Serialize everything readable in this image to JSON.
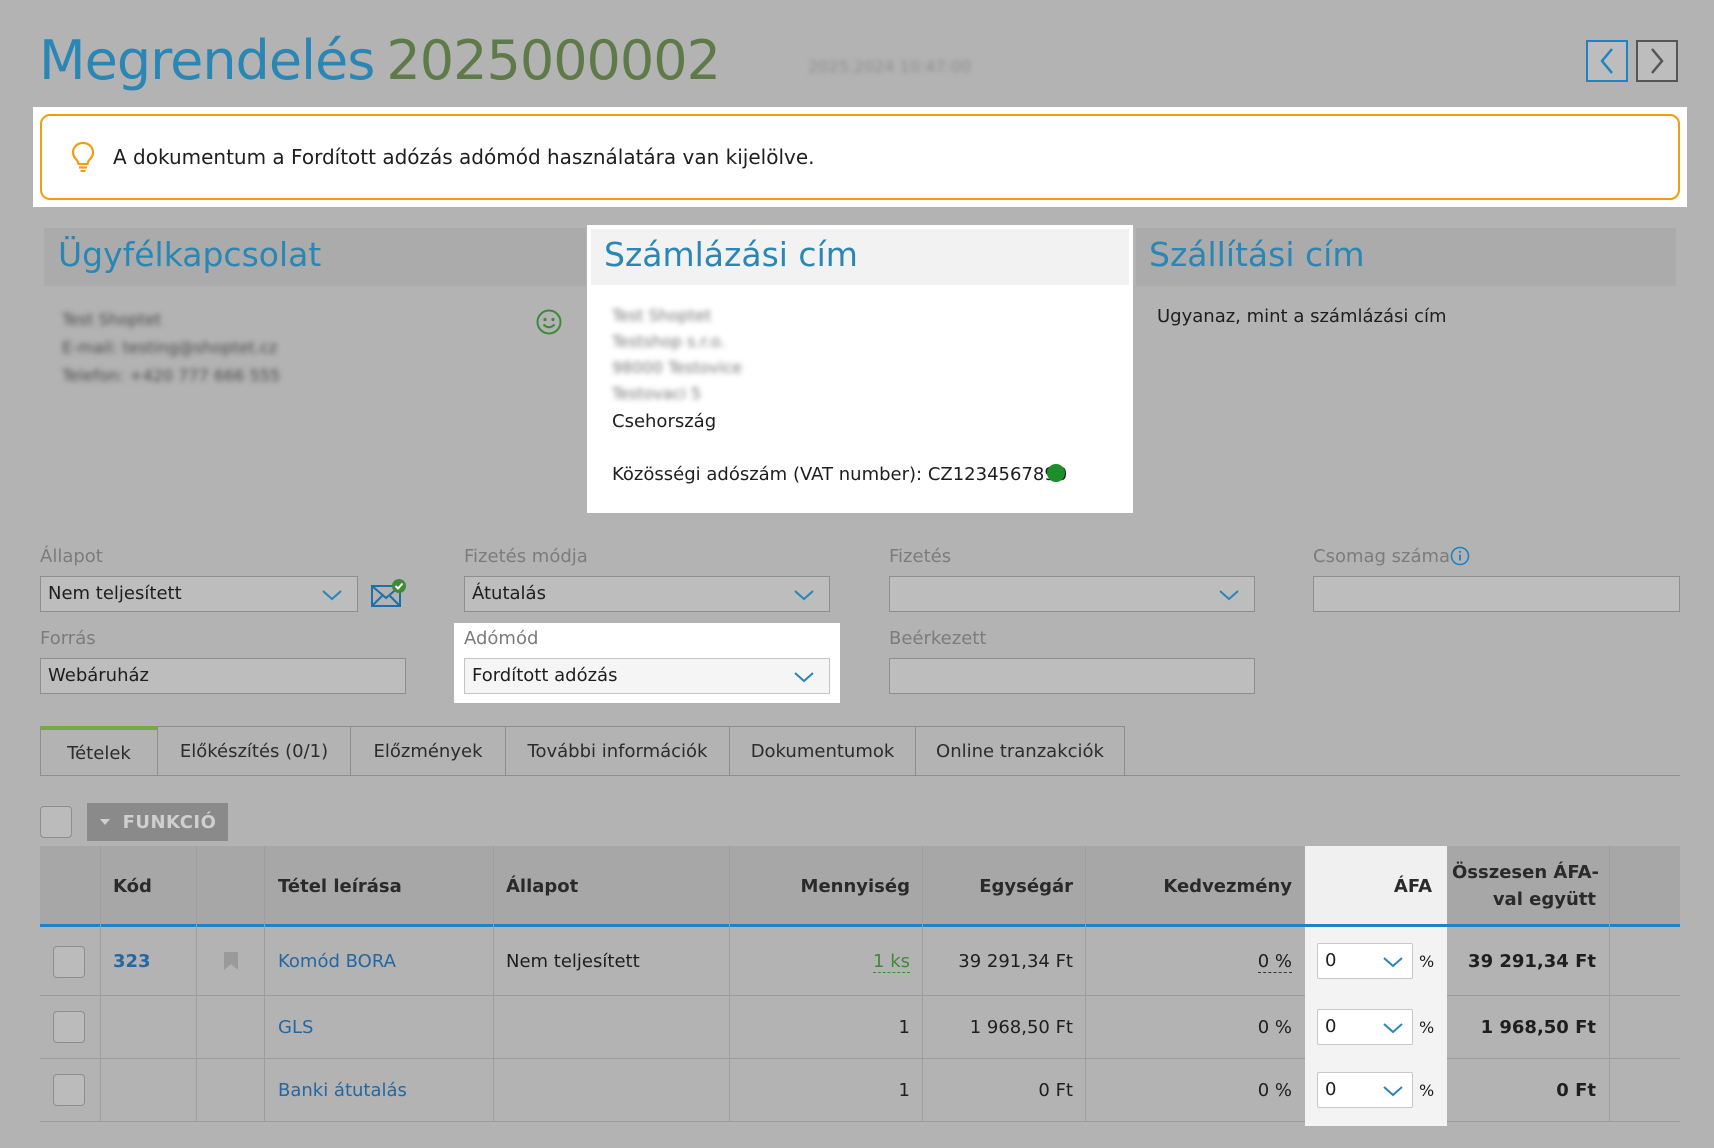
{
  "header": {
    "title_word": "Megrendelés",
    "title_number": "2025000002",
    "date_blurred": "2025.2024 10:47:00"
  },
  "notice": {
    "text": "A dokumentum a Fordított adózás adómód használatára van kijelölve."
  },
  "customer": {
    "title": "Ügyfélkapcsolat",
    "name": "Test Shoptet",
    "email_line": "E-mail: testing@shoptet.cz",
    "phone_line": "Telefon: +420 777 666 555"
  },
  "billing": {
    "title": "Számlázási cím",
    "line1": "Test Shoptet",
    "line2": "Testshop s.r.o.",
    "line3": "98000 Testovice",
    "line4": "Testovaci 5",
    "country": "Csehország",
    "vat_label": "Közösségi adószám (VAT number): CZ1234567890"
  },
  "shipping": {
    "title": "Szállítási cím",
    "text": "Ugyanaz, mint a számlázási cím"
  },
  "form": {
    "allapot_label": "Állapot",
    "allapot_value": "Nem teljesített",
    "fizmod_label": "Fizetés módja",
    "fizmod_value": "Átutalás",
    "fizetes_label": "Fizetés",
    "fizetes_value": "",
    "csomag_label": "Csomag száma",
    "csomag_value": "",
    "forras_label": "Forrás",
    "forras_value": "Webáruház",
    "adomod_label": "Adómód",
    "adomod_value": "Fordított adózás",
    "beerkezett_label": "Beérkezett",
    "beerkezett_value": ""
  },
  "tabs": [
    {
      "label": "Tételek"
    },
    {
      "label": "Előkészítés (0/1)"
    },
    {
      "label": "Előzmények"
    },
    {
      "label": "További információk"
    },
    {
      "label": "Dokumentumok"
    },
    {
      "label": "Online tranzakciók"
    }
  ],
  "toolbar": {
    "funkcio_label": "FUNKCIÓ"
  },
  "table": {
    "headers": {
      "kod": "Kód",
      "leiras": "Tétel leírása",
      "allapot": "Állapot",
      "mennyiseg": "Mennyiség",
      "egysegar": "Egységár",
      "kedvezmeny": "Kedvezmény",
      "afa": "ÁFA",
      "osszesen1": "Összesen ÁFA-",
      "osszesen2": "val együtt"
    },
    "rows": [
      {
        "kod": "323",
        "leiras": "Komód BORA",
        "allapot": "Nem teljesített",
        "mennyiseg": "1 ks",
        "egysegar": "39 291,34 Ft",
        "kedvezmeny": "0 %",
        "afa": "0",
        "pct": "%",
        "osszesen": "39 291,34 Ft"
      },
      {
        "kod": "",
        "leiras": "GLS",
        "allapot": "",
        "mennyiseg": "1",
        "egysegar": "1 968,50 Ft",
        "kedvezmeny": "0 %",
        "afa": "0",
        "pct": "%",
        "osszesen": "1 968,50 Ft"
      },
      {
        "kod": "",
        "leiras": "Banki átutalás",
        "allapot": "",
        "mennyiseg": "1",
        "egysegar": "0 Ft",
        "kedvezmeny": "0 %",
        "afa": "0",
        "pct": "%",
        "osszesen": "0 Ft"
      }
    ]
  },
  "colors": {
    "accent_blue": "#2a86b4",
    "number_green": "#5e7a48",
    "notice_orange": "#f39c12",
    "table_line_blue": "#1d83c4",
    "vat_valid_green": "#1d8f2a"
  }
}
